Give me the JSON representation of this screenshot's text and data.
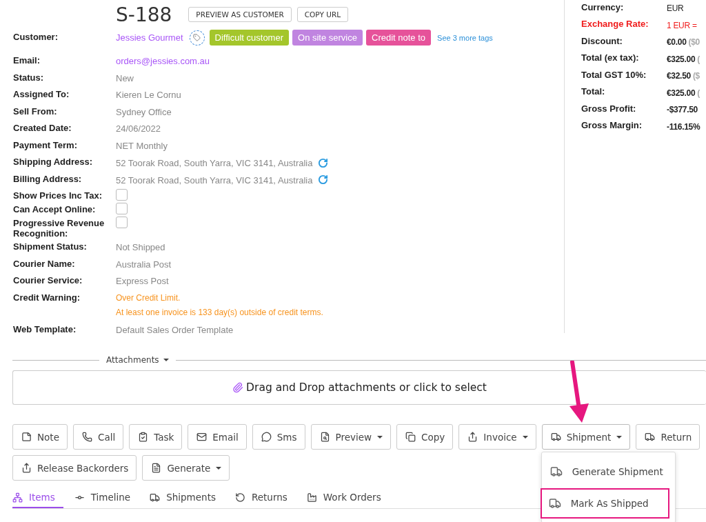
{
  "header": {
    "title": "S-188",
    "buttons": [
      "PREVIEW AS CUSTOMER",
      "COPY URL"
    ]
  },
  "fields": [
    {
      "label": "Customer:",
      "kind": "customer",
      "value": "Jessies Gourmet",
      "tags": [
        {
          "label": "Difficult customer",
          "color": "#a4c62b"
        },
        {
          "label": "On site service",
          "color": "#c084e0"
        },
        {
          "label": "Credit note to",
          "color": "#e6529a"
        }
      ],
      "more": "See 3 more tags"
    },
    {
      "label": "Email:",
      "kind": "link",
      "value": "orders@jessies.com.au"
    },
    {
      "label": "Status:",
      "kind": "text",
      "value": "New"
    },
    {
      "label": "Assigned To:",
      "kind": "text",
      "value": "Kieren Le Cornu"
    },
    {
      "label": "Sell From:",
      "kind": "text",
      "value": "Sydney Office"
    },
    {
      "label": "Created Date:",
      "kind": "text",
      "value": "24/06/2022"
    },
    {
      "label": "Payment Term:",
      "kind": "text",
      "value": "NET Monthly"
    },
    {
      "label": "Shipping Address:",
      "kind": "address",
      "value": "52 Toorak Road, South Yarra, VIC 3141, Australia"
    },
    {
      "label": "Billing Address:",
      "kind": "address",
      "value": "52 Toorak Road, South Yarra, VIC 3141, Australia"
    },
    {
      "label": "Show Prices Inc Tax:",
      "kind": "checkbox",
      "checked": false
    },
    {
      "label": "Can Accept Online:",
      "kind": "checkbox",
      "checked": false
    },
    {
      "label": "Progressive Revenue Recognition:",
      "kind": "checkbox",
      "checked": false
    },
    {
      "label": "Shipment Status:",
      "kind": "text",
      "value": "Not Shipped"
    },
    {
      "label": "Courier Name:",
      "kind": "text",
      "value": "Australia Post"
    },
    {
      "label": "Courier Service:",
      "kind": "text",
      "value": "Express Post"
    },
    {
      "label": "Credit Warning:",
      "kind": "warning",
      "lines": [
        "Over Credit Limit.",
        "At least one invoice is 133 day(s) outside of credit terms."
      ]
    },
    {
      "label": "Web Template:",
      "kind": "text",
      "value": "Default Sales Order Template"
    }
  ],
  "totals": [
    {
      "label": "Currency:",
      "kind": "normal",
      "value": "EUR"
    },
    {
      "label": "Exchange Rate:",
      "kind": "alert",
      "value": "1 EUR ="
    },
    {
      "label": "Discount:",
      "kind": "normal",
      "value": "€0.00",
      "extra": "($0"
    },
    {
      "label": "Total (ex tax):",
      "kind": "normal",
      "value": "€325.00",
      "extra": "("
    },
    {
      "label": "Total GST 10%:",
      "kind": "normal",
      "value": "€32.50",
      "extra": "($"
    },
    {
      "label": "Total:",
      "kind": "normal",
      "value": "€325.00",
      "extra": "("
    },
    {
      "label": "Gross Profit:",
      "kind": "normal",
      "value": "-$377.50"
    },
    {
      "label": "Gross Margin:",
      "kind": "normal",
      "value": "-116.15%"
    }
  ],
  "attachments": {
    "label": "Attachments",
    "dropzone": "Drag and Drop attachments or click to select"
  },
  "toolbar_rows": [
    {
      "buttons": [
        {
          "label": "Note",
          "dropdown": false,
          "expanded": false
        },
        {
          "label": "Call",
          "dropdown": false,
          "expanded": false
        },
        {
          "label": "Task",
          "dropdown": false,
          "expanded": false
        },
        {
          "label": "Email",
          "dropdown": false,
          "expanded": false
        },
        {
          "label": "Sms",
          "dropdown": false,
          "expanded": false
        },
        {
          "label": "Preview",
          "dropdown": true,
          "expanded": false
        },
        {
          "label": "Copy",
          "dropdown": false,
          "expanded": false
        },
        {
          "label": "Invoice",
          "dropdown": true,
          "expanded": false
        },
        {
          "label": "Shipment",
          "dropdown": true,
          "expanded": true,
          "menu": [
            {
              "label": "Generate Shipment",
              "highlighted": false
            },
            {
              "label": "Mark As Shipped",
              "highlighted": true
            }
          ]
        },
        {
          "label": "Return",
          "dropdown": false,
          "expanded": false
        }
      ]
    },
    {
      "buttons": [
        {
          "label": "Release Backorders",
          "dropdown": false,
          "expanded": false
        },
        {
          "label": "Generate",
          "dropdown": true,
          "expanded": false
        }
      ]
    }
  ],
  "tabs": [
    {
      "label": "Items",
      "selected": true
    },
    {
      "label": "Timeline",
      "selected": false
    },
    {
      "label": "Shipments",
      "selected": false
    },
    {
      "label": "Returns",
      "selected": false
    },
    {
      "label": "Work Orders",
      "selected": false
    }
  ]
}
